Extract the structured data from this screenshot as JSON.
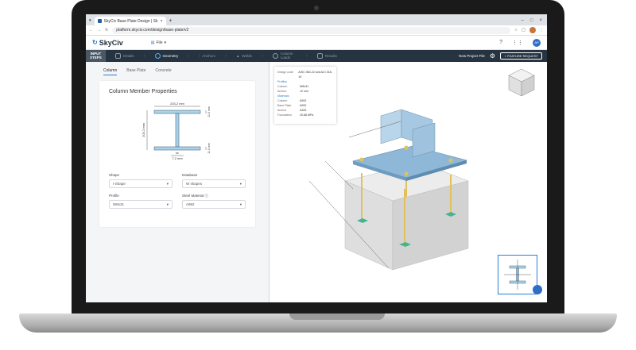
{
  "browser": {
    "tab_title": "SkyCiv Base Plate Design | Sk",
    "tab_close": "×",
    "tab_new": "+",
    "url": "platform.skyciv.com/design/base-plate/v2",
    "window_controls": [
      "–",
      "□",
      "×"
    ]
  },
  "header": {
    "logo": "SkyCiv",
    "file_menu": "File",
    "help_icon": "?",
    "grid_icon": "⋮⋮",
    "user_initials": "AP"
  },
  "steps": {
    "input_label_1": "INPUT",
    "input_label_2": "STEPS",
    "items": [
      {
        "label": "Details"
      },
      {
        "label": "Geometry"
      },
      {
        "label": "Anchors"
      },
      {
        "label": "Welds"
      },
      {
        "label": "Column Loads"
      },
      {
        "label": "Results"
      }
    ],
    "new_project": "New Project File",
    "feature_request": "FEATURE REQUEST"
  },
  "left": {
    "tabs": [
      "Column",
      "Base Plate",
      "Concrete"
    ],
    "card_title": "Column Member Properties",
    "dims": {
      "bf": "203.2 mm",
      "d": "203.2 mm",
      "tf_top": "11.0 mm",
      "tf_bot": "11.0 mm",
      "tw_label": "tw",
      "tw": "7.2 mm"
    },
    "fields": {
      "shape_label": "Shape",
      "shape_value": "I-Shape",
      "database_label": "Database",
      "database_value": "W shapes",
      "profile_label": "Profile",
      "profile_value": "W8x31",
      "material_label": "Steel Material",
      "material_value": "A992"
    }
  },
  "info": {
    "design_code_k": "Design code",
    "design_code_v": "AISC 360-22 and ACI 318-19",
    "profiles_title": "Profiles",
    "profile_rows": [
      {
        "k": "Column",
        "v": "W8x31"
      },
      {
        "k": "Anchor",
        "v": "12 mm"
      }
    ],
    "materials_title": "Materials",
    "material_rows": [
      {
        "k": "Column",
        "v": "A992"
      },
      {
        "k": "Base Plate",
        "v": "A992"
      },
      {
        "k": "Anchor",
        "v": "A325"
      },
      {
        "k": "Foundation",
        "v": "20.68 MPa"
      }
    ]
  },
  "colors": {
    "brand": "#2a7fd4",
    "steps_bg": "#263341",
    "plate": "#8fb8d8",
    "anchor": "#e3c15a",
    "grout_pad": "#46b58f",
    "concrete": "#dcdcdc"
  }
}
